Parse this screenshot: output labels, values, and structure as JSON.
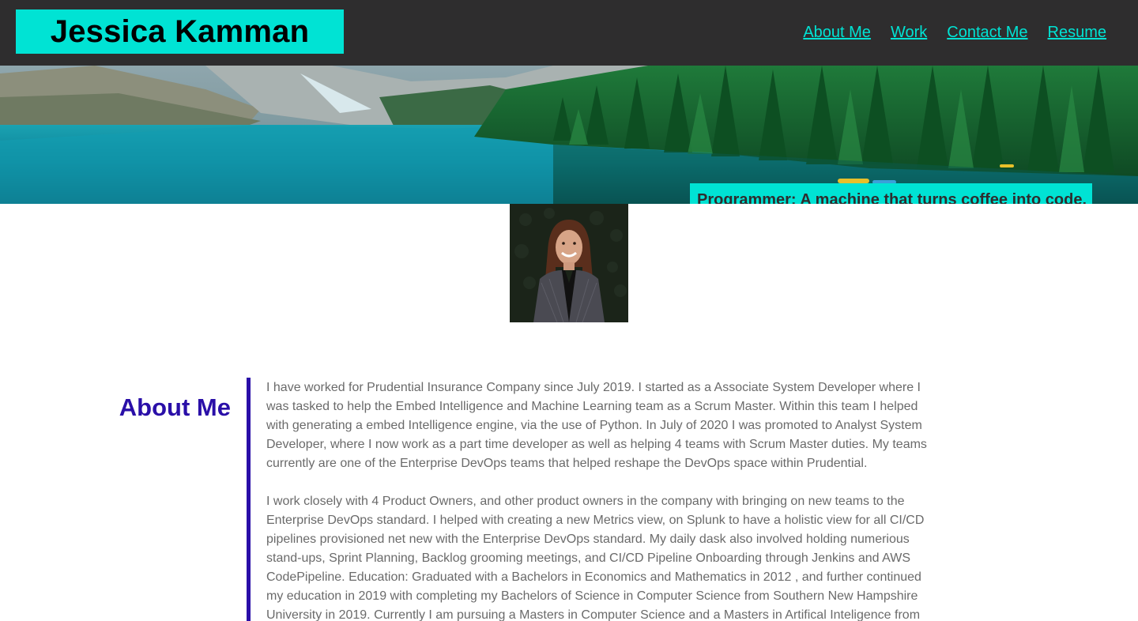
{
  "header": {
    "brand": "Jessica Kamman",
    "nav": [
      "About Me",
      "Work",
      "Contact Me",
      "Resume"
    ]
  },
  "hero": {
    "tagline": "Programmer: A machine that turns coffee into code."
  },
  "profile": {
    "photo_alt": "Profile photo of Jessica Kamman"
  },
  "about": {
    "heading": "About Me",
    "paragraphs": [
      "I have worked for Prudential Insurance Company since July 2019. I started as a Associate System Developer where I was tasked to help the Embed Intelligence and Machine Learning team as a Scrum Master. Within this team I helped with generating a embed Intelligence engine, via the use of Python. In July of 2020 I was promoted to Analyst System Developer, where I now work as a part time developer as well as helping 4 teams with Scrum Master duties. My teams currently are one of the Enterprise DevOps teams that helped reshape the DevOps space within Prudential.",
      "I work closely with 4 Product Owners, and other product owners in the company with bringing on new teams to the Enterprise DevOps standard. I helped with creating a new Metrics view, on Splunk to have a holistic view for all CI/CD pipelines provisioned net new with the Enterprise DevOps standard. My daily dask also involved holding numerious stand-ups, Sprint Planning, Backlog grooming meetings, and CI/CD Pipeline Onboarding through Jenkins and AWS CodePipeline. Education: Graduated with a Bachelors in Economics and Mathematics in 2012 , and further continued my education in 2019 with completing my Bachelors of Science in Computer Science from Southern New Hampshire University in 2019. Currently I am pursuing a Masters in Computer Science and a Masters in Artifical Inteligence from"
    ]
  },
  "colors": {
    "accent": "#00e3d4",
    "header_bg": "#2e2d2e",
    "heading": "#2a0fa8",
    "body_text": "#6a6a6a"
  }
}
